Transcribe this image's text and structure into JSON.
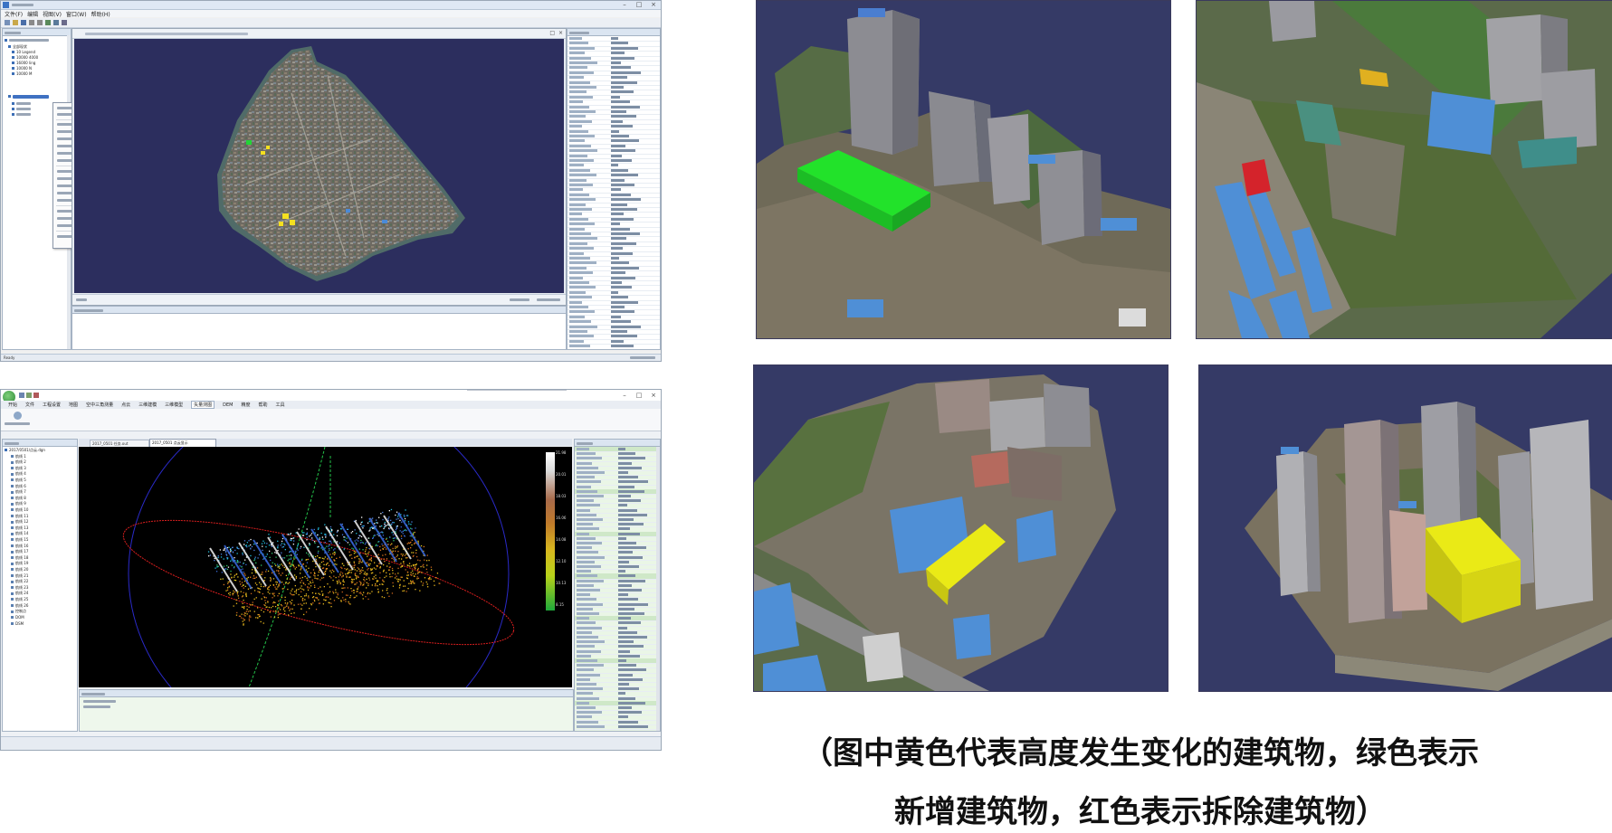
{
  "windowA": {
    "menu": [
      "文件(F)",
      "编辑",
      "视图(V)",
      "窗口(W)",
      "帮助(H)"
    ],
    "tree_items": [
      "全部现状",
      "10 Legend",
      "10000 4000",
      "16000 ling",
      "10000 N",
      "10000 M"
    ],
    "status_left": "Ready"
  },
  "windowB": {
    "tabs": [
      "开始",
      "文件",
      "工程设置",
      "地图",
      "空中三角测量",
      "点云",
      "三维建模",
      "三维模型",
      "矢量测图",
      "DEM",
      "精度",
      "帮助",
      "工具"
    ],
    "active_tab_index": 8,
    "doc_tabs": [
      "2017_0501 任务.out",
      "2017_0501 点云显示"
    ],
    "tree_root": "2017/0501/点云.dgn",
    "tree_items": [
      "航线 1",
      "航线 2",
      "航线 3",
      "航线 4",
      "航线 5",
      "航线 6",
      "航线 7",
      "航线 8",
      "航线 9",
      "航线 10",
      "航线 11",
      "航线 12",
      "航线 13",
      "航线 14",
      "航线 15",
      "航线 16",
      "航线 17",
      "航线 18",
      "航线 19",
      "航线 20",
      "航线 21",
      "航线 22",
      "航线 23",
      "航线 24",
      "航线 25",
      "航线 26",
      "控制点",
      "DOM",
      "DSM"
    ],
    "legend_ticks": [
      "21.98",
      "20.01",
      "18.03",
      "16.06",
      "14.08",
      "12.10",
      "10.13",
      "8.15"
    ],
    "colors": {
      "viewport_bg": "#000000",
      "ring_outer": "#2a2ac8",
      "ring_red": "#d81e1e",
      "axis_green": "#23c44a"
    }
  },
  "scenes": {
    "colors": {
      "sky": "#353a66",
      "added_building": "#22e22a",
      "height_changed_building": "#eaea16",
      "removed_building": "#d4232b",
      "roof_blue": "#4f8fd6"
    }
  },
  "caption": {
    "line1": "（图中黄色代表高度发生变化的建筑物，绿色表示",
    "line2": "新增建筑物，红色表示拆除建筑物）"
  }
}
